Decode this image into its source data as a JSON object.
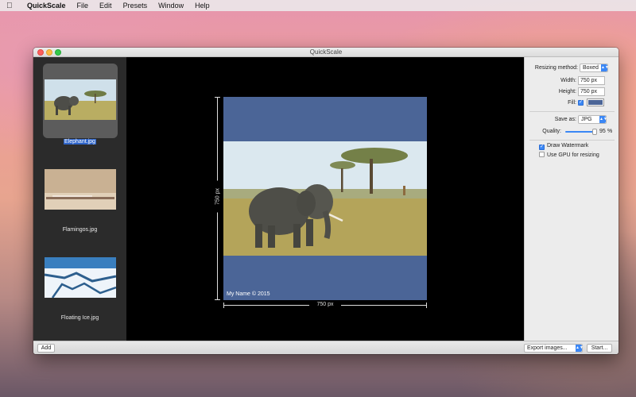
{
  "menubar": {
    "apple_icon": "apple-logo-icon",
    "app_name": "QuickScale",
    "items": [
      "File",
      "Edit",
      "Presets",
      "Window",
      "Help"
    ]
  },
  "window": {
    "title": "QuickScale"
  },
  "sidebar": {
    "items": [
      {
        "label": "Elephant.jpg",
        "selected": true
      },
      {
        "label": "Flamingos.jpg",
        "selected": false
      },
      {
        "label": "Floating Ice.jpg",
        "selected": false
      }
    ]
  },
  "preview": {
    "fill_color": "#4b6597",
    "watermark": "My Name © 2015",
    "width_label": "750 px",
    "height_label": "750 px"
  },
  "settings": {
    "resizing_method_label": "Resizing method:",
    "resizing_method_value": "Boxed",
    "width_label": "Width:",
    "width_value": "750 px",
    "height_label": "Height:",
    "height_value": "750 px",
    "fill_label": "Fill:",
    "fill_enabled": true,
    "save_as_label": "Save as:",
    "save_as_value": "JPG",
    "quality_label": "Quality:",
    "quality_value": "95",
    "quality_unit": "%",
    "draw_watermark_label": "Draw Watermark",
    "draw_watermark": true,
    "use_gpu_label": "Use GPU for resizing",
    "use_gpu": false
  },
  "bottombar": {
    "add_label": "Add",
    "export_label": "Export images...",
    "start_label": "Start..."
  }
}
